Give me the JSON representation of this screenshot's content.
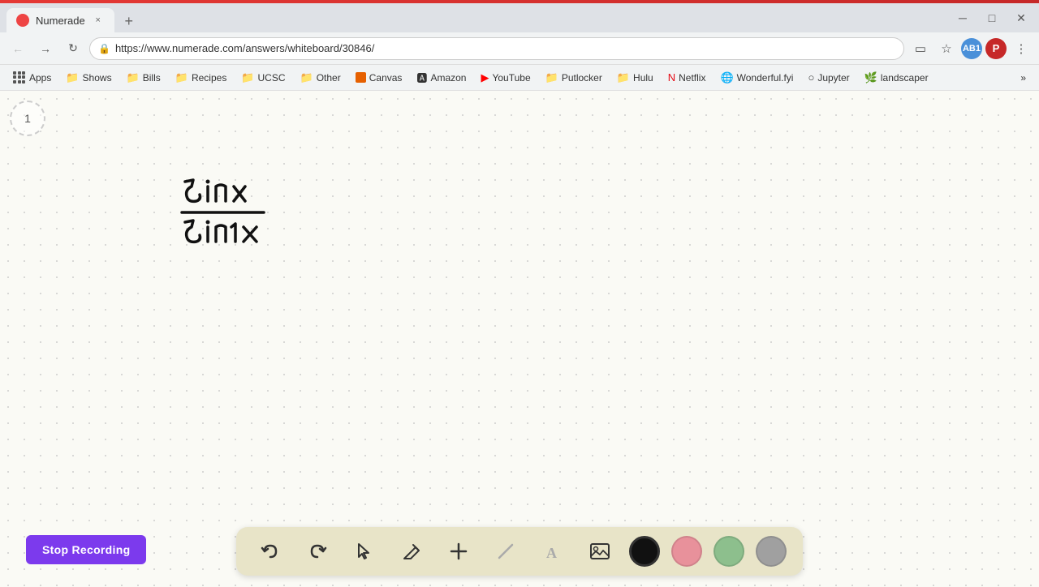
{
  "browser": {
    "tab": {
      "title": "Numerade",
      "favicon_color": "#e44",
      "close_label": "×",
      "new_tab_label": "+"
    },
    "toolbar": {
      "url": "https://www.numerade.com/answers/whiteboard/30846/",
      "back_label": "←",
      "forward_label": "→",
      "refresh_label": "↻",
      "home_label": "⌂",
      "more_label": "⋮",
      "cast_label": "▭",
      "star_label": "☆",
      "ext_badge": "AB1",
      "profile_label": "P"
    },
    "bookmarks": [
      {
        "id": "apps",
        "label": "Apps",
        "type": "apps"
      },
      {
        "id": "shows",
        "label": "Shows",
        "type": "folder"
      },
      {
        "id": "bills",
        "label": "Bills",
        "type": "folder"
      },
      {
        "id": "recipes",
        "label": "Recipes",
        "type": "folder"
      },
      {
        "id": "ucsc",
        "label": "UCSC",
        "type": "folder"
      },
      {
        "id": "other",
        "label": "Other",
        "type": "folder"
      },
      {
        "id": "canvas",
        "label": "Canvas",
        "type": "canvas"
      },
      {
        "id": "amazon",
        "label": "Amazon",
        "type": "amazon"
      },
      {
        "id": "youtube",
        "label": "YouTube",
        "type": "youtube"
      },
      {
        "id": "putlocker",
        "label": "Putlocker",
        "type": "folder"
      },
      {
        "id": "hulu",
        "label": "Hulu",
        "type": "folder"
      },
      {
        "id": "netflix",
        "label": "Netflix",
        "type": "netflix"
      },
      {
        "id": "wonderfulfyi",
        "label": "Wonderful.fyi",
        "type": "folder"
      },
      {
        "id": "jupyter",
        "label": "Jupyter",
        "type": "folder"
      },
      {
        "id": "landscaper",
        "label": "landscaper",
        "type": "folder"
      }
    ],
    "more_bookmarks_label": "»"
  },
  "whiteboard": {
    "page_number": "1",
    "math_expression": "5inx / 5in1x",
    "stop_recording_label": "Stop Recording"
  },
  "toolbar_tools": {
    "undo_label": "↩",
    "redo_label": "↪",
    "select_label": "▷",
    "pen_label": "✏",
    "add_label": "+",
    "eraser_label": "/",
    "text_label": "A",
    "image_label": "▦",
    "colors": [
      {
        "id": "black",
        "hex": "#111111",
        "active": true
      },
      {
        "id": "pink",
        "hex": "#e8919b",
        "active": false
      },
      {
        "id": "green",
        "hex": "#8dbf8d",
        "active": false
      },
      {
        "id": "gray",
        "hex": "#a0a0a0",
        "active": false
      }
    ]
  }
}
